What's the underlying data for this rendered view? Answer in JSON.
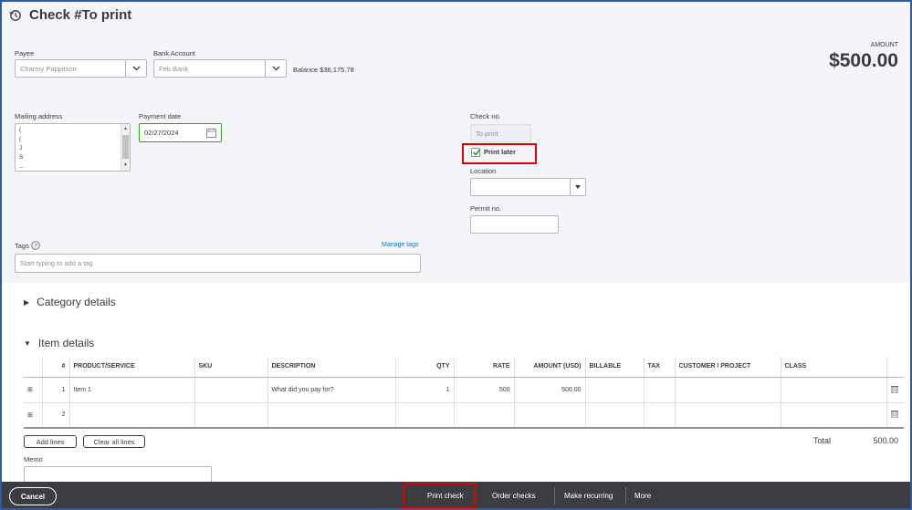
{
  "header": {
    "title": "Check #To print",
    "amount_label": "AMOUNT",
    "amount": "$500.00"
  },
  "payee": {
    "label": "Payee",
    "value": "Charmy Pappitson"
  },
  "bank": {
    "label": "Bank Account",
    "value": "Feb Bank",
    "balance_label": "Balance",
    "balance": "$36,175.78"
  },
  "mailing": {
    "label": "Mailing address",
    "lines": [
      "(",
      "(",
      "J",
      "S",
      "..."
    ]
  },
  "payment_date": {
    "label": "Payment date",
    "value": "02/27/2024"
  },
  "check_no": {
    "label": "Check no.",
    "value": "To print"
  },
  "print_later": {
    "label": "Print later",
    "checked": true
  },
  "location": {
    "label": "Location",
    "value": ""
  },
  "permit": {
    "label": "Permit no.",
    "value": ""
  },
  "tags": {
    "label": "Tags",
    "manage": "Manage tags",
    "placeholder": "Start typing to add a tag"
  },
  "category_section": {
    "label": "Category details"
  },
  "item_section": {
    "label": "Item details"
  },
  "table": {
    "headers": [
      "#",
      "PRODUCT/SERVICE",
      "SKU",
      "DESCRIPTION",
      "QTY",
      "RATE",
      "AMOUNT (USD)",
      "BILLABLE",
      "TAX",
      "CUSTOMER / PROJECT",
      "CLASS"
    ],
    "rows": [
      {
        "num": "1",
        "product": "Item 1",
        "sku": "",
        "description": "What did you pay for?",
        "qty": "1",
        "rate": "500",
        "amount": "500.00"
      },
      {
        "num": "2",
        "product": "",
        "sku": "",
        "description": "",
        "qty": "",
        "rate": "",
        "amount": ""
      }
    ]
  },
  "buttons": {
    "add_lines": "Add lines",
    "clear_lines": "Clear all lines"
  },
  "total": {
    "label": "Total",
    "value": "500.00"
  },
  "memo": {
    "label": "Memo"
  },
  "footer": {
    "cancel": "Cancel",
    "print_check": "Print check",
    "order_checks": "Order checks",
    "make_recurring": "Make recurring",
    "more": "More"
  },
  "colors": {
    "highlight": "#e00000",
    "footer_bg": "#3b3d40",
    "date_border": "#2ca01c",
    "link": "#0077c5"
  }
}
